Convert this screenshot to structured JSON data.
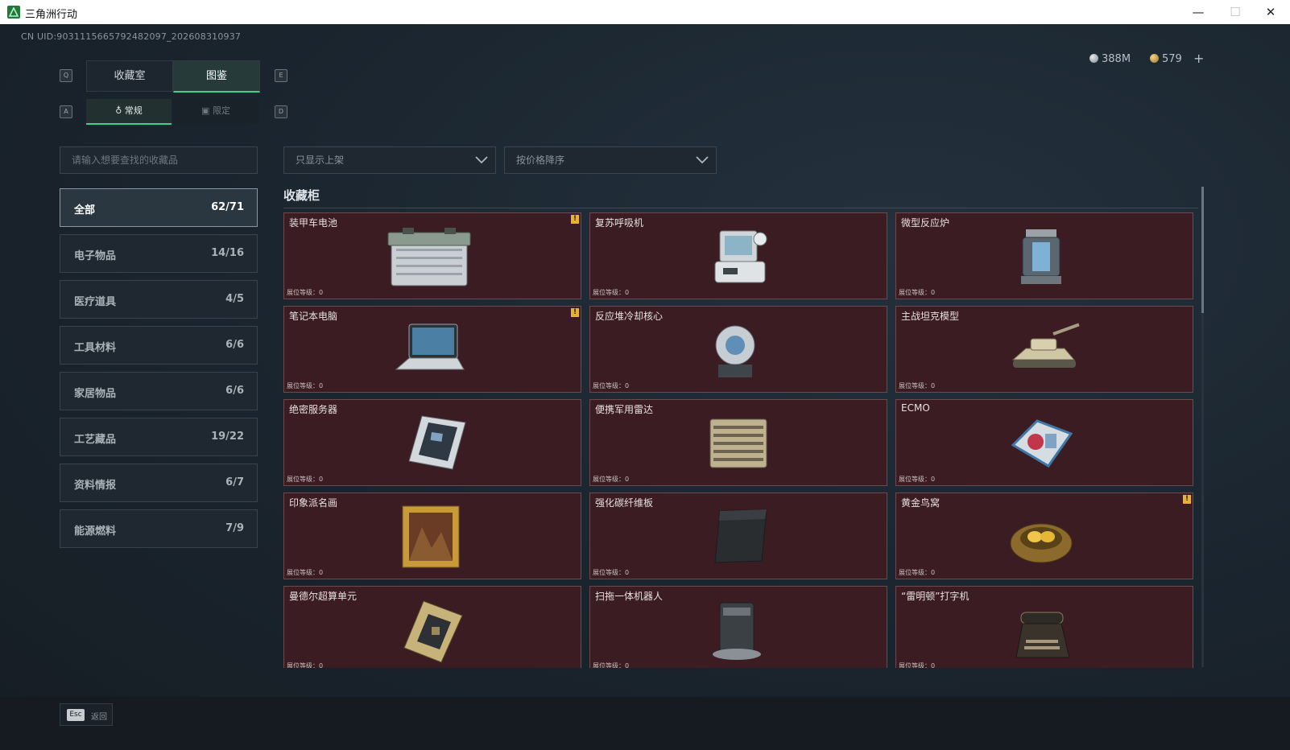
{
  "window": {
    "title": "三角洲行动",
    "minimize": "—",
    "maximize": "☐",
    "close": "✕"
  },
  "uid": "CN UID:903111566579248209​7_202608310937",
  "currency": {
    "silver": "388M",
    "gold": "579",
    "add": "+"
  },
  "hints": {
    "q": "Q",
    "e": "E",
    "a": "A",
    "d": "D"
  },
  "tabs": [
    {
      "label": "收藏室"
    },
    {
      "label": "图鉴"
    }
  ],
  "subtabs": [
    {
      "label": "常规"
    },
    {
      "label": "限定"
    }
  ],
  "search": {
    "placeholder": "请输入想要查找的收藏品"
  },
  "filters": {
    "shelf": "只显示上架",
    "sort": "按价格降序"
  },
  "categories": [
    {
      "label": "全部",
      "count": "62/71"
    },
    {
      "label": "电子物品",
      "count": "14/16"
    },
    {
      "label": "医疗道具",
      "count": "4/5"
    },
    {
      "label": "工具材料",
      "count": "6/6"
    },
    {
      "label": "家居物品",
      "count": "6/6"
    },
    {
      "label": "工艺藏品",
      "count": "19/22"
    },
    {
      "label": "资料情报",
      "count": "6/7"
    },
    {
      "label": "能源燃料",
      "count": "7/9"
    }
  ],
  "section": {
    "title": "收藏柜"
  },
  "level_label": "展位等级：0",
  "items": [
    {
      "name": "装甲车电池",
      "icon": "battery-icon",
      "warn": "!"
    },
    {
      "name": "复苏呼吸机",
      "icon": "ventilator-icon",
      "warn": ""
    },
    {
      "name": "微型反应炉",
      "icon": "reactor-icon",
      "warn": ""
    },
    {
      "name": "笔记本电脑",
      "icon": "laptop-icon",
      "warn": "!"
    },
    {
      "name": "反应堆冷却核心",
      "icon": "cooling-core-icon",
      "warn": ""
    },
    {
      "name": "主战坦克模型",
      "icon": "tank-model-icon",
      "warn": ""
    },
    {
      "name": "绝密服务器",
      "icon": "server-icon",
      "warn": ""
    },
    {
      "name": "便携军用雷达",
      "icon": "radar-icon",
      "warn": ""
    },
    {
      "name": "ECMO",
      "icon": "ecmo-icon",
      "warn": ""
    },
    {
      "name": "印象派名画",
      "icon": "painting-icon",
      "warn": ""
    },
    {
      "name": "强化碳纤维板",
      "icon": "carbon-plate-icon",
      "warn": ""
    },
    {
      "name": "黄金鸟窝",
      "icon": "golden-nest-icon",
      "warn": "!"
    },
    {
      "name": "曼德尔超算单元",
      "icon": "supercomputer-icon",
      "warn": ""
    },
    {
      "name": "扫拖一体机器人",
      "icon": "robot-vacuum-icon",
      "warn": ""
    },
    {
      "name": "“雷明顿”打字机",
      "icon": "typewriter-icon",
      "warn": ""
    }
  ],
  "footer": {
    "key": "Esc",
    "label": "返回"
  },
  "colors": {
    "accent": "#3fcf8e",
    "card_bg": "#3b1c22",
    "warn": "#e9b22e"
  }
}
